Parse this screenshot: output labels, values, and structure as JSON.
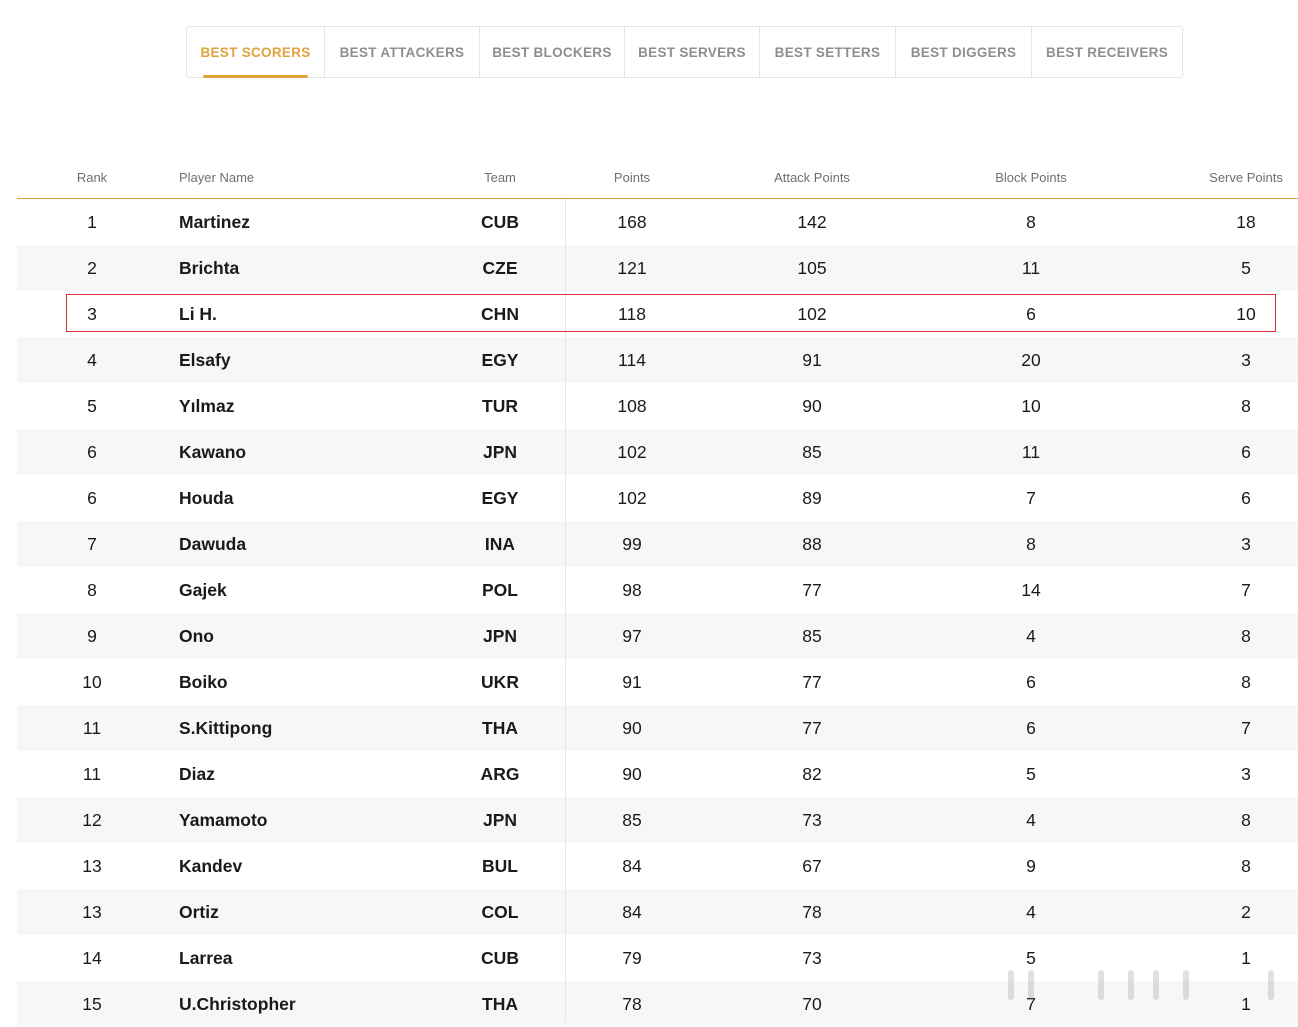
{
  "tabs": [
    {
      "label": "BEST SCORERS",
      "active": true
    },
    {
      "label": "BEST ATTACKERS",
      "active": false
    },
    {
      "label": "BEST BLOCKERS",
      "active": false
    },
    {
      "label": "BEST SERVERS",
      "active": false
    },
    {
      "label": "BEST SETTERS",
      "active": false
    },
    {
      "label": "BEST DIGGERS",
      "active": false
    },
    {
      "label": "BEST RECEIVERS",
      "active": false
    }
  ],
  "table": {
    "headers": {
      "rank": "Rank",
      "player": "Player Name",
      "team": "Team",
      "points": "Points",
      "attack": "Attack Points",
      "block": "Block Points",
      "serve": "Serve Points"
    },
    "rows": [
      [
        "1",
        "Martinez",
        "CUB",
        "168",
        "142",
        "8",
        "18"
      ],
      [
        "2",
        "Brichta",
        "CZE",
        "121",
        "105",
        "11",
        "5"
      ],
      [
        "3",
        "Li H.",
        "CHN",
        "118",
        "102",
        "6",
        "10"
      ],
      [
        "4",
        "Elsafy",
        "EGY",
        "114",
        "91",
        "20",
        "3"
      ],
      [
        "5",
        "Yılmaz",
        "TUR",
        "108",
        "90",
        "10",
        "8"
      ],
      [
        "6",
        "Kawano",
        "JPN",
        "102",
        "85",
        "11",
        "6"
      ],
      [
        "6",
        "Houda",
        "EGY",
        "102",
        "89",
        "7",
        "6"
      ],
      [
        "7",
        "Dawuda",
        "INA",
        "99",
        "88",
        "8",
        "3"
      ],
      [
        "8",
        "Gajek",
        "POL",
        "98",
        "77",
        "14",
        "7"
      ],
      [
        "9",
        "Ono",
        "JPN",
        "97",
        "85",
        "4",
        "8"
      ],
      [
        "10",
        "Boiko",
        "UKR",
        "91",
        "77",
        "6",
        "8"
      ],
      [
        "11",
        "S.Kittipong",
        "THA",
        "90",
        "77",
        "6",
        "7"
      ],
      [
        "11",
        "Diaz",
        "ARG",
        "90",
        "82",
        "5",
        "3"
      ],
      [
        "12",
        "Yamamoto",
        "JPN",
        "85",
        "73",
        "4",
        "8"
      ],
      [
        "13",
        "Kandev",
        "BUL",
        "84",
        "67",
        "9",
        "8"
      ],
      [
        "13",
        "Ortiz",
        "COL",
        "84",
        "78",
        "4",
        "2"
      ],
      [
        "14",
        "Larrea",
        "CUB",
        "79",
        "73",
        "5",
        "1"
      ],
      [
        "15",
        "U.Christopher",
        "THA",
        "78",
        "70",
        "7",
        "1"
      ]
    ],
    "highlighted_row_index": 2
  },
  "colors": {
    "accent": "#e0a33b",
    "highlight_border": "#d93030",
    "row_alt": "#f7f7f7"
  }
}
